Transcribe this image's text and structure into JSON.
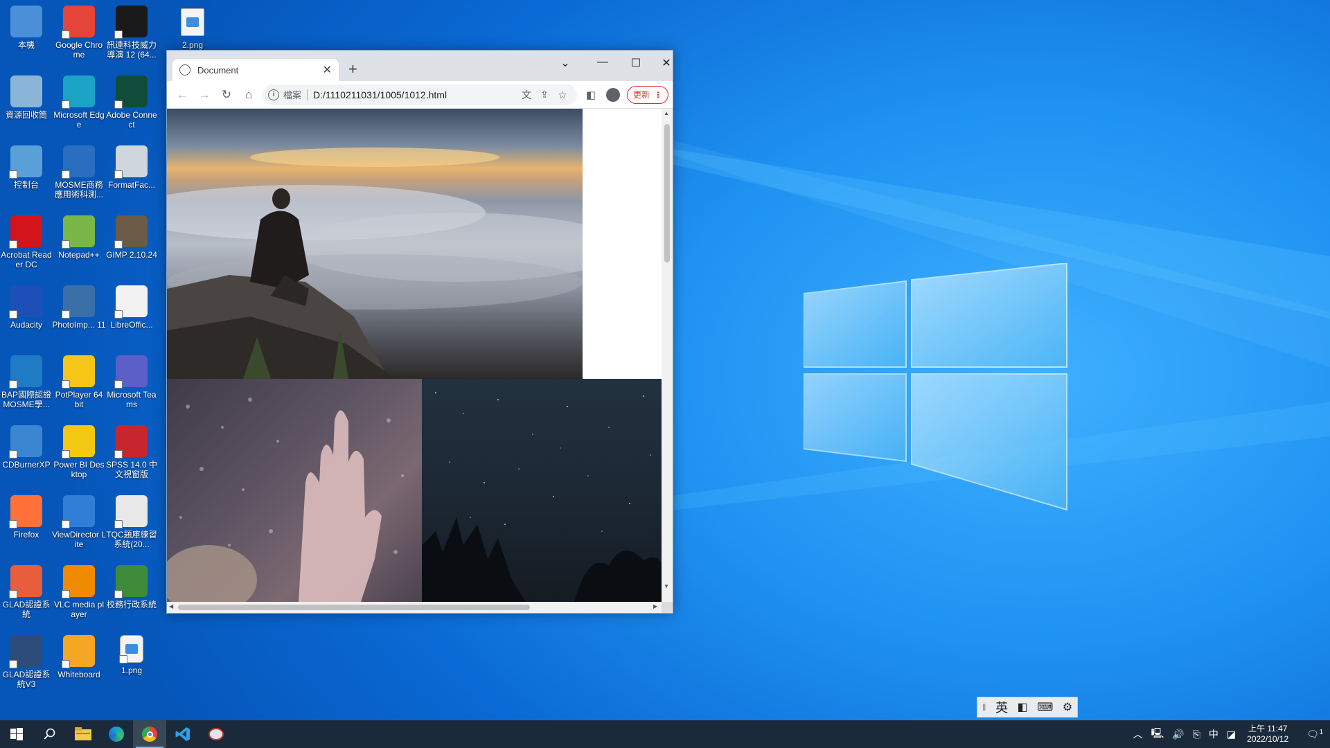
{
  "desktop": {
    "icons": [
      {
        "label": "本機",
        "icon": "computer-icon",
        "color": "#4a8fd8"
      },
      {
        "label": "Google Chrome",
        "icon": "chrome-icon",
        "color": "#e5443a"
      },
      {
        "label": "訊連科技威力導演 12 (64...",
        "icon": "powerdirector-icon",
        "color": "#1a1a1a"
      },
      {
        "label": "資源回收筒",
        "icon": "recycle-bin-icon",
        "color": "#8ab4d8"
      },
      {
        "label": "Microsoft Edge",
        "icon": "edge-icon",
        "color": "#1ba3c6"
      },
      {
        "label": "Adobe Connect",
        "icon": "adobe-connect-icon",
        "color": "#0f4d3a"
      },
      {
        "label": "控制台",
        "icon": "control-panel-icon",
        "color": "#5aa0d8"
      },
      {
        "label": "MOSME商務應用術科測...",
        "icon": "mosme-icon",
        "color": "#2a6fbf"
      },
      {
        "label": "FormatFac...",
        "icon": "formatfactory-icon",
        "color": "#cfd6dd"
      },
      {
        "label": "Acrobat Reader DC",
        "icon": "acrobat-icon",
        "color": "#d4141b"
      },
      {
        "label": "Notepad++",
        "icon": "notepadpp-icon",
        "color": "#7ab648"
      },
      {
        "label": "GIMP 2.10.24",
        "icon": "gimp-icon",
        "color": "#6b5a45"
      },
      {
        "label": "Audacity",
        "icon": "audacity-icon",
        "color": "#1e4fb8"
      },
      {
        "label": "PhotoImp... 11",
        "icon": "photoimpact-icon",
        "color": "#3b6fa8"
      },
      {
        "label": "LibreOffic...",
        "icon": "libreoffice-icon",
        "color": "#f2f2f2"
      },
      {
        "label": "BAP國際認證MOSME學...",
        "icon": "bap-icon",
        "color": "#1d7cc4"
      },
      {
        "label": "PotPlayer 64 bit",
        "icon": "potplayer-icon",
        "color": "#f5c518"
      },
      {
        "label": "Microsoft Teams",
        "icon": "teams-icon",
        "color": "#5b5fc7"
      },
      {
        "label": "CDBurnerXP",
        "icon": "cdburnerxp-icon",
        "color": "#3a86d0"
      },
      {
        "label": "Power BI Desktop",
        "icon": "powerbi-icon",
        "color": "#f2c811"
      },
      {
        "label": "SPSS 14.0 中文視窗版",
        "icon": "spss-icon",
        "color": "#c8262f"
      },
      {
        "label": "Firefox",
        "icon": "firefox-icon",
        "color": "#ff7139"
      },
      {
        "label": "ViewDirector Lite",
        "icon": "viewdirector-icon",
        "color": "#2f7fd6"
      },
      {
        "label": "TQC題庫練習系統(20...",
        "icon": "tqc-icon",
        "color": "#e8e8e8"
      },
      {
        "label": "GLAD認證系統",
        "icon": "glad-icon",
        "color": "#e85d3c"
      },
      {
        "label": "VLC media player",
        "icon": "vlc-icon",
        "color": "#f08a00"
      },
      {
        "label": "校務行政系統",
        "icon": "school-admin-icon",
        "color": "#3e8b3a"
      },
      {
        "label": "GLAD認證系統V3",
        "icon": "glad-v3-icon",
        "color": "#2d4c7a"
      },
      {
        "label": "Whiteboard",
        "icon": "whiteboard-icon",
        "color": "#f5a623"
      },
      {
        "label": "1.png",
        "icon": "image-file-icon",
        "color": "#f4f4f4"
      }
    ],
    "extra_file": {
      "label": "2.png",
      "icon": "image-file-icon"
    }
  },
  "browser": {
    "tab_title": "Document",
    "new_tab": "+",
    "address_scheme": "檔案",
    "address_url": "D:/1110211031/1005/1012.html",
    "update_label": "更新",
    "dots": "⋮"
  },
  "ime": {
    "mode": "英"
  },
  "taskbar": {
    "clock_period_time": "上午 11:47",
    "clock_date": "2022/10/12",
    "ime_lang": "中",
    "notification_count": "1"
  }
}
